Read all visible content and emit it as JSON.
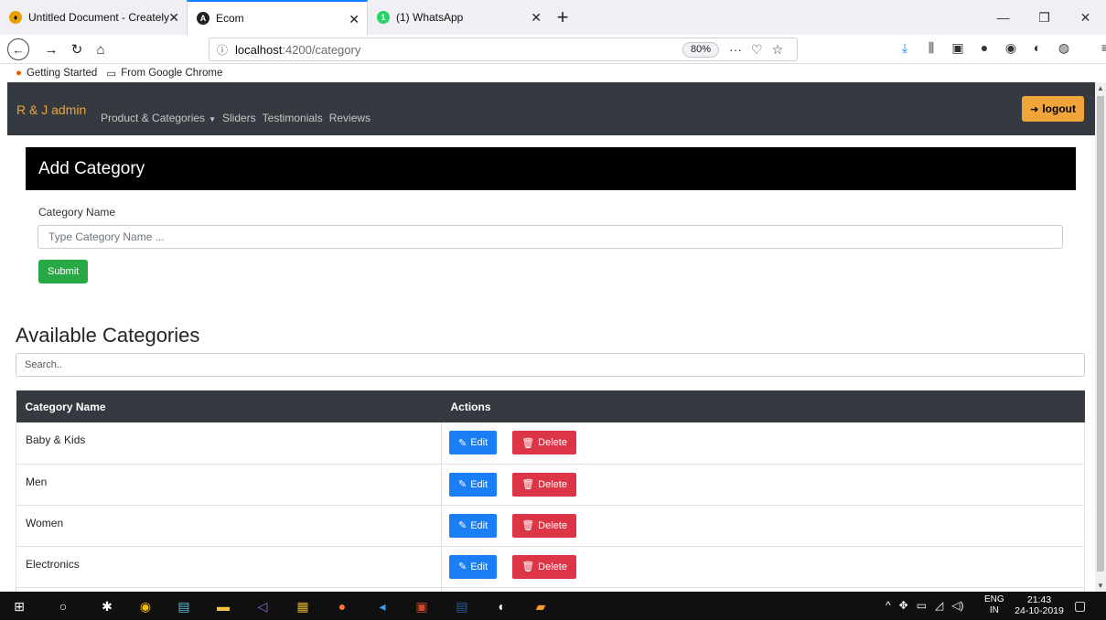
{
  "browser": {
    "tabs": [
      {
        "title": "Untitled Document - Creately",
        "icon": "creately-icon"
      },
      {
        "title": "Ecom",
        "icon": "angular-icon"
      },
      {
        "title": "(1) WhatsApp",
        "icon": "whatsapp-icon"
      }
    ],
    "url_host": "localhost",
    "url_path": ":4200/category",
    "zoom": "80%",
    "bookmarks": [
      "Getting Started",
      "From Google Chrome"
    ]
  },
  "app": {
    "brand": "R & J admin",
    "menu": [
      "Product & Categories",
      "Sliders",
      "Testimonials",
      "Reviews"
    ],
    "logout_label": "logout"
  },
  "add_category": {
    "title": "Add Category",
    "field_label": "Category Name",
    "placeholder": "Type Category Name ...",
    "submit_label": "Submit"
  },
  "available": {
    "title": "Available Categories",
    "search_placeholder": "Search..",
    "columns": [
      "Category Name",
      "Actions"
    ],
    "rows": [
      "Baby & Kids",
      "Men",
      "Women",
      "Electronics"
    ],
    "edit_label": "Edit",
    "delete_label": "Delete"
  },
  "taskbar": {
    "lang": [
      "ENG",
      "IN"
    ],
    "time": "21:43",
    "date": "24-10-2019"
  },
  "colors": {
    "navbar": "#343a40",
    "brand": "#f0a43a",
    "submit": "#28a745",
    "edit": "#1a7ef5",
    "delete": "#dc3545"
  }
}
